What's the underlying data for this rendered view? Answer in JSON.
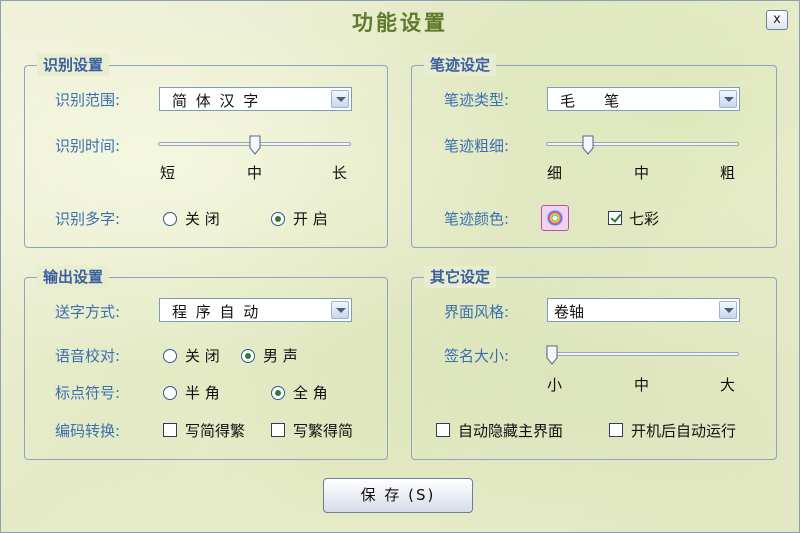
{
  "window": {
    "title": "功能设置",
    "close_label": "x"
  },
  "recognition": {
    "title": "识别设置",
    "range_label": "识别范围:",
    "range_value": "简 体 汉 字",
    "time_label": "识别时间:",
    "time_ticks": [
      "短",
      "中",
      "长"
    ],
    "time_level": 0.5,
    "multi_label": "识别多字:",
    "multi_options": [
      "关 闭",
      "开 启"
    ],
    "multi_selected": "开 启"
  },
  "stroke": {
    "title": "笔迹设定",
    "type_label": "笔迹类型:",
    "type_value": "毛    笔",
    "width_label": "笔迹粗细:",
    "width_ticks": [
      "细",
      "中",
      "粗"
    ],
    "width_level": 0.2,
    "color_label": "笔迹颜色:",
    "color_icon": "rainbow-color-icon",
    "rainbow_label": "七彩",
    "rainbow_checked": true
  },
  "output": {
    "title": "输出设置",
    "send_label": "送字方式:",
    "send_value": "程 序 自 动",
    "voice_label": "语音校对:",
    "voice_options": [
      "关 闭",
      "男 声"
    ],
    "voice_selected": "男 声",
    "punct_label": "标点符号:",
    "punct_options": [
      "半 角",
      "全 角"
    ],
    "punct_selected": "全 角",
    "encode_label": "编码转换:",
    "encode_options": [
      "写简得繁",
      "写繁得简"
    ],
    "encode_checked": [
      false,
      false
    ]
  },
  "other": {
    "title": "其它设定",
    "style_label": "界面风格:",
    "style_value": "卷轴",
    "sig_label": "签名大小:",
    "sig_ticks": [
      "小",
      "中",
      "大"
    ],
    "sig_level": 0.0,
    "autohide_label": "自动隐藏主界面",
    "autohide_checked": false,
    "autorun_label": "开机后自动运行",
    "autorun_checked": false
  },
  "footer": {
    "save_label": "保 存 (S)"
  },
  "colors": {
    "label_blue": "#3a6fb0",
    "group_title_blue": "#3a5fa0",
    "title_green": "#5e7a2a",
    "radio_dot_green": "#2f7d2f"
  }
}
